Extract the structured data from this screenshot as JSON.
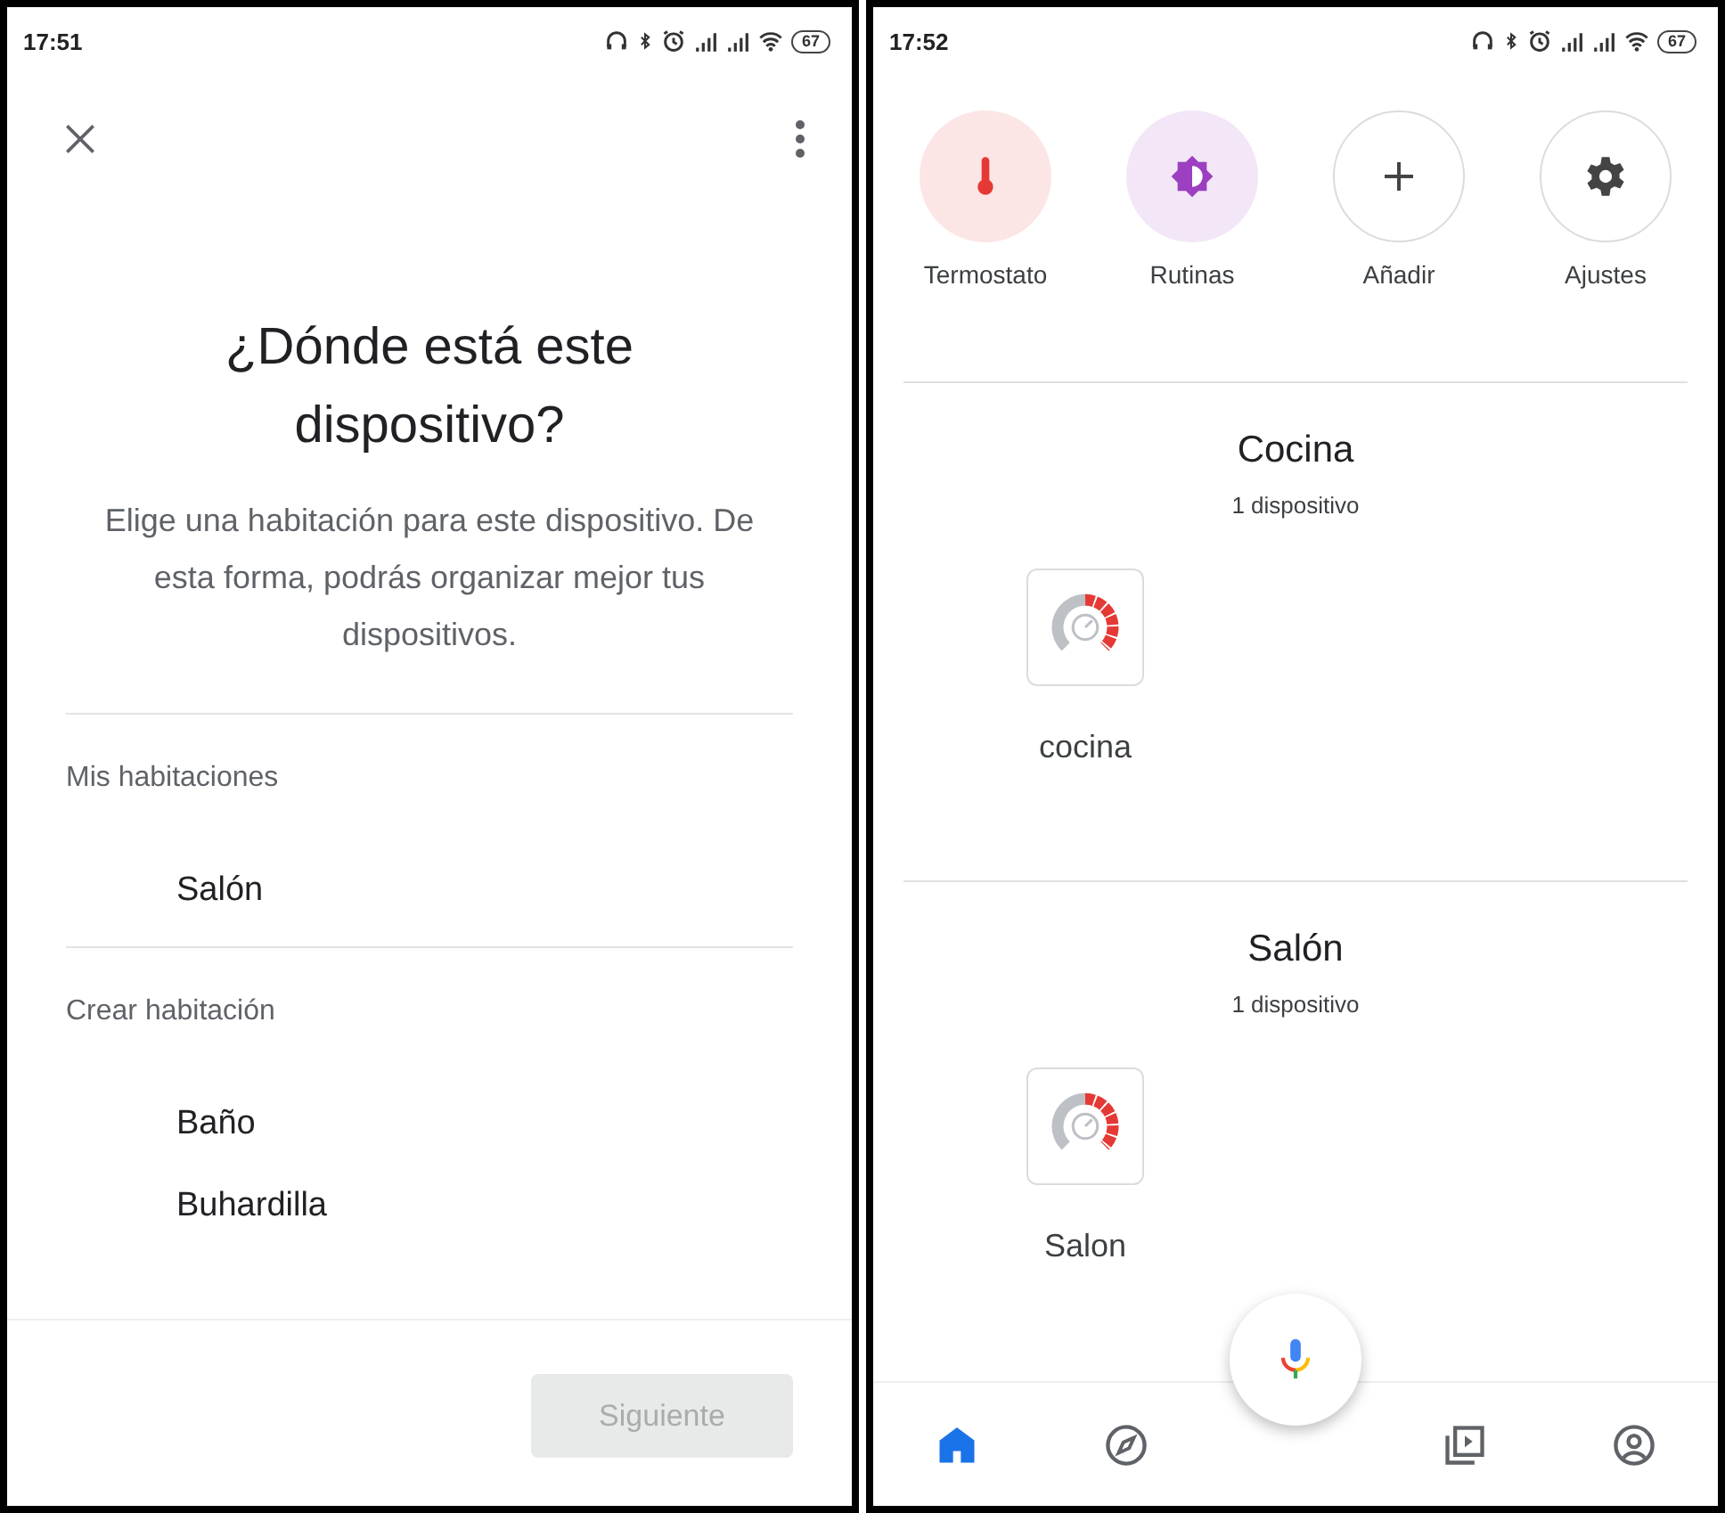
{
  "setup_screen": {
    "status_bar": {
      "time": "17:51",
      "battery": "67"
    },
    "title": "¿Dónde está este dispositivo?",
    "description": "Elige una habitación para este dispositivo. De esta forma, podrás organizar mejor tus dispositivos.",
    "sections": [
      {
        "heading": "Mis habitaciones",
        "rooms": [
          "Salón"
        ]
      },
      {
        "heading": "Crear habitación",
        "rooms": [
          "Baño",
          "Buhardilla"
        ]
      }
    ],
    "next_button": {
      "label": "Siguiente",
      "disabled": true
    }
  },
  "home_screen": {
    "status_bar": {
      "time": "17:52",
      "battery": "67"
    },
    "shortcuts": [
      {
        "label": "Termostato",
        "kind": "filled",
        "color": "#e53935"
      },
      {
        "label": "Rutinas",
        "kind": "filled",
        "color": "#9c3fc0"
      },
      {
        "label": "Añadir",
        "kind": "outlined"
      },
      {
        "label": "Ajustes",
        "kind": "outlined"
      }
    ],
    "rooms": [
      {
        "name": "Cocina",
        "count": "1 dispositivo",
        "devices": [
          {
            "name": "cocina"
          }
        ]
      },
      {
        "name": "Salón",
        "count": "1 dispositivo",
        "devices": [
          {
            "name": "Salon"
          }
        ]
      }
    ],
    "nav": [
      {
        "selected": true
      },
      {
        "selected": false
      },
      {
        "selected": false
      },
      {
        "selected": false
      }
    ]
  }
}
